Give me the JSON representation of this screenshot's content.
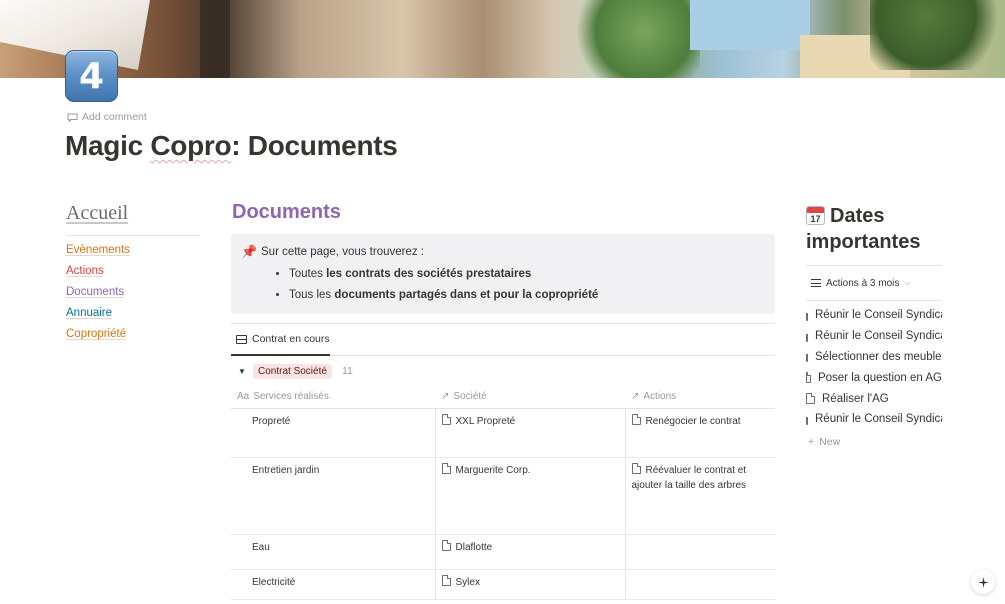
{
  "cover": {
    "icon_name": "cover-photo"
  },
  "page": {
    "icon_value": "4",
    "add_comment": "Add comment",
    "title": "Magic Copro: Documents"
  },
  "left_nav": {
    "heading": "Accueil",
    "items": [
      {
        "label": "Evènements",
        "color": "#d9730d"
      },
      {
        "label": "Actions",
        "color": "#e03e3e"
      },
      {
        "label": "Documents",
        "color": "#9065b0"
      },
      {
        "label": "Annuaire",
        "color": "#0b6e99"
      },
      {
        "label": "Copropriété",
        "color": "#d9730d"
      }
    ]
  },
  "main": {
    "title": "Documents",
    "title_color": "#9065b0",
    "callout": {
      "icon": "📌",
      "intro": "Sur cette page, vous trouverez :",
      "bullets": [
        {
          "prefix": "Toutes ",
          "bold": "les contrats des sociétés prestataires"
        },
        {
          "prefix": "Tous les ",
          "bold": "documents partagés dans et pour la copropriété"
        }
      ]
    },
    "view_tab": "Contrat en cours",
    "group": {
      "label": "Contrat Société",
      "count": "11"
    },
    "columns": {
      "services": "Services réalisés",
      "societe": "Société",
      "actions": "Actions"
    },
    "rows": [
      {
        "service": "Propreté",
        "societe": "XXL Propreté",
        "action": "Renégocier le contrat"
      },
      {
        "service": "Entretien jardin",
        "societe": "Marguerite Corp.",
        "action": "Réévaluer le contrat et ajouter la taille des arbres"
      },
      {
        "service": "Eau",
        "societe": "Dlaflotte",
        "action": ""
      },
      {
        "service": "Electricité",
        "societe": "Sylex",
        "action": ""
      }
    ]
  },
  "right": {
    "title_line1": "Dates",
    "title_line2": "importantes",
    "calendar_day": "17",
    "view_label": "Actions à 3 mois",
    "items": [
      "Réunir le Conseil Syndical",
      "Réunir le Conseil Syndical",
      "Sélectionner des meubles",
      "Poser la question en AG",
      "Réaliser l'AG",
      "Réunir le Conseil Syndical"
    ],
    "new_label": "New"
  }
}
